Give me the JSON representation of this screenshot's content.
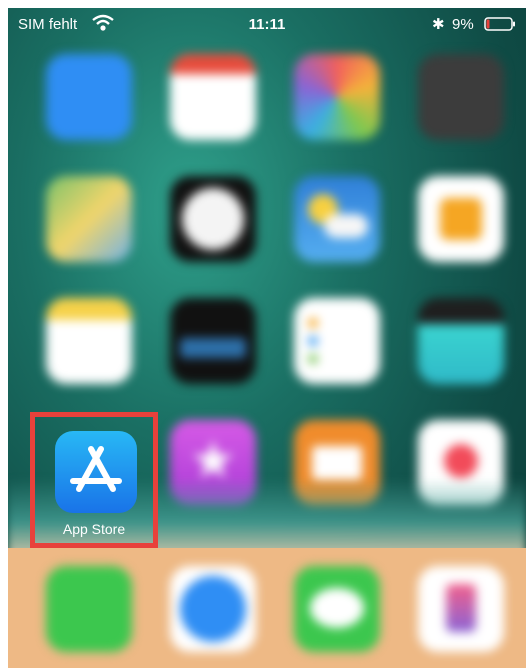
{
  "status_bar": {
    "carrier": "SIM fehlt",
    "time": "11:11",
    "bluetooth": "✱",
    "battery_percent": "9%"
  },
  "highlighted_app": {
    "label": "App Store",
    "highlight_color": "#e8413b"
  },
  "home_grid": {
    "rows": [
      [
        {
          "icon": "mail-icon",
          "color": "#2f8ef4"
        },
        {
          "icon": "calendar-icon",
          "color": "#ffffff"
        },
        {
          "icon": "photos-icon",
          "color": "#f5b33a"
        },
        {
          "icon": "camera-icon",
          "color": "#3c3c3c"
        }
      ],
      [
        {
          "icon": "maps-icon",
          "color": "#7bc26a"
        },
        {
          "icon": "clock-icon",
          "color": "#111111"
        },
        {
          "icon": "weather-icon",
          "color": "#3f92e8"
        },
        {
          "icon": "home-icon",
          "color": "#ffffff"
        }
      ],
      [
        {
          "icon": "notes-icon",
          "color": "#ffffff"
        },
        {
          "icon": "stocks-icon",
          "color": "#111111"
        },
        {
          "icon": "reminders-icon",
          "color": "#ffffff"
        },
        {
          "icon": "videos-icon",
          "color": "#3ad4d0"
        }
      ],
      [
        {
          "icon": "app-store-icon",
          "color": "#1d8ef0"
        },
        {
          "icon": "itunes-star-icon",
          "color": "#c44bd8"
        },
        {
          "icon": "books-icon",
          "color": "#f08c2c"
        },
        {
          "icon": "health-icon",
          "color": "#ffffff"
        }
      ]
    ]
  },
  "dock": [
    {
      "icon": "phone-icon",
      "color": "#3cc74e"
    },
    {
      "icon": "safari-icon",
      "color": "#2f8ef4"
    },
    {
      "icon": "messages-icon",
      "color": "#3cc74e"
    },
    {
      "icon": "music-icon",
      "color": "#ffffff"
    }
  ]
}
